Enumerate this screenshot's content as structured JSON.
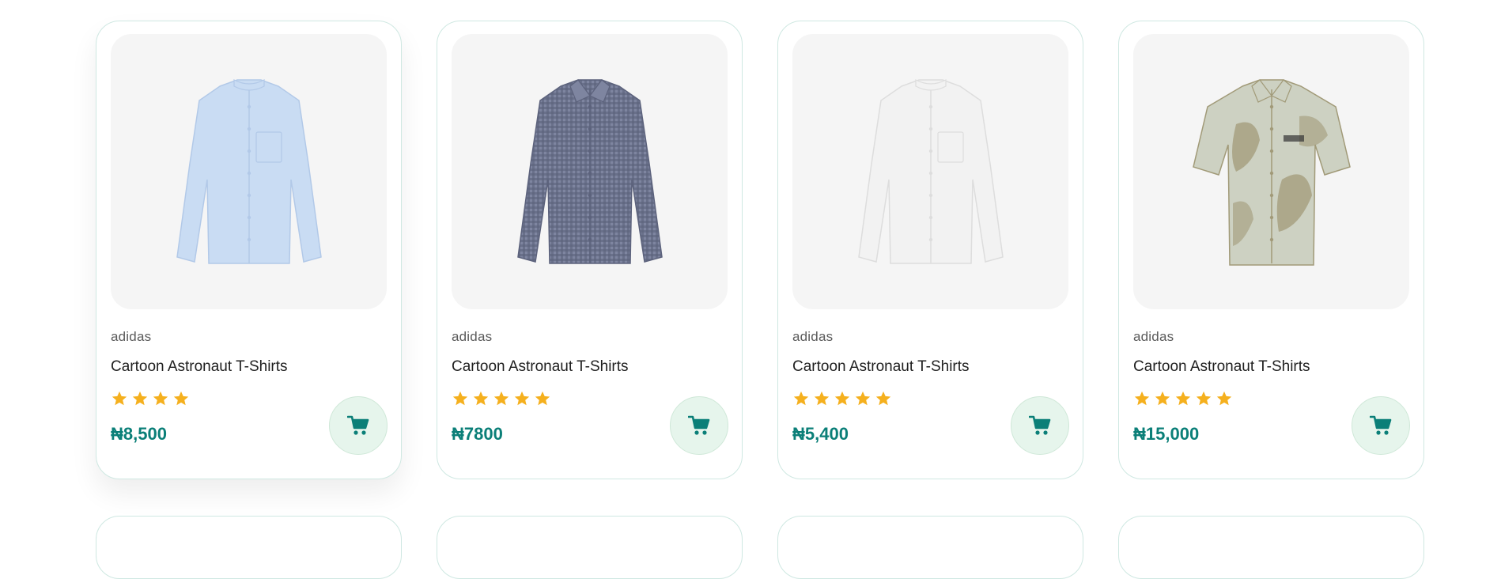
{
  "products": [
    {
      "brand": "adidas",
      "title": "Cartoon Astronaut T-Shirts",
      "rating": 4,
      "price": "₦8,500",
      "shirt": {
        "body": "#c9dcf3",
        "shade": "#b2c9e8",
        "pattern": "plain",
        "sleeves": "long",
        "collar": "band"
      }
    },
    {
      "brand": "adidas",
      "title": "Cartoon Astronaut T-Shirts",
      "rating": 5,
      "price": "₦7800",
      "shirt": {
        "body": "#7e85a0",
        "shade": "#5c627c",
        "pattern": "gingham",
        "sleeves": "long",
        "collar": "spread"
      }
    },
    {
      "brand": "adidas",
      "title": "Cartoon Astronaut T-Shirts",
      "rating": 5,
      "price": "₦5,400",
      "shirt": {
        "body": "#f2f2f2",
        "shade": "#dddddd",
        "pattern": "plain",
        "sleeves": "long",
        "collar": "band"
      }
    },
    {
      "brand": "adidas",
      "title": "Cartoon Astronaut T-Shirts",
      "rating": 5,
      "price": "₦15,000",
      "shirt": {
        "body": "#cdd1c2",
        "shade": "#a19a78",
        "pattern": "floral",
        "sleeves": "short",
        "collar": "spread"
      }
    }
  ],
  "colors": {
    "accent": "#0b7f78",
    "star": "#f5b01e",
    "cart_bg": "#e6f5ec",
    "card_border": "#cfe8e2"
  },
  "icons": {
    "rating": "star-icon",
    "cart": "cart-icon"
  }
}
